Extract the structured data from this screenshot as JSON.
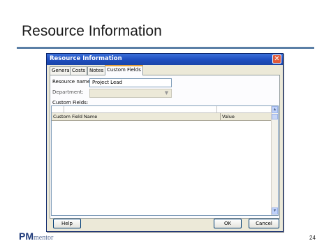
{
  "slide": {
    "title": "Resource Information",
    "page_number": "24",
    "logo": {
      "bold": "PM",
      "light": "mentor"
    }
  },
  "dialog": {
    "title": "Resource Information",
    "close_glyph": "✕",
    "tabs": [
      {
        "label": "General",
        "active": false
      },
      {
        "label": "Costs",
        "active": false
      },
      {
        "label": "Notes",
        "active": false
      },
      {
        "label": "Custom Fields",
        "active": true
      }
    ],
    "resource_name": {
      "label": "Resource name:",
      "value": "Project Lead"
    },
    "department": {
      "label": "Department:",
      "value": ""
    },
    "custom_fields": {
      "label": "Custom Fields:",
      "columns": [
        "Custom Field Name",
        "Value"
      ],
      "rows": []
    },
    "buttons": {
      "help": "Help",
      "ok": "OK",
      "cancel": "Cancel"
    }
  },
  "colors": {
    "title_rule": "#5b7fa6",
    "titlebar": "#1f4fc0",
    "logo": "#1f3a7a"
  },
  "icons": {
    "close": "close-icon",
    "dropdown": "chevron-down-icon",
    "scroll_up": "scroll-up-arrow-icon",
    "scroll_down": "scroll-down-arrow-icon"
  }
}
